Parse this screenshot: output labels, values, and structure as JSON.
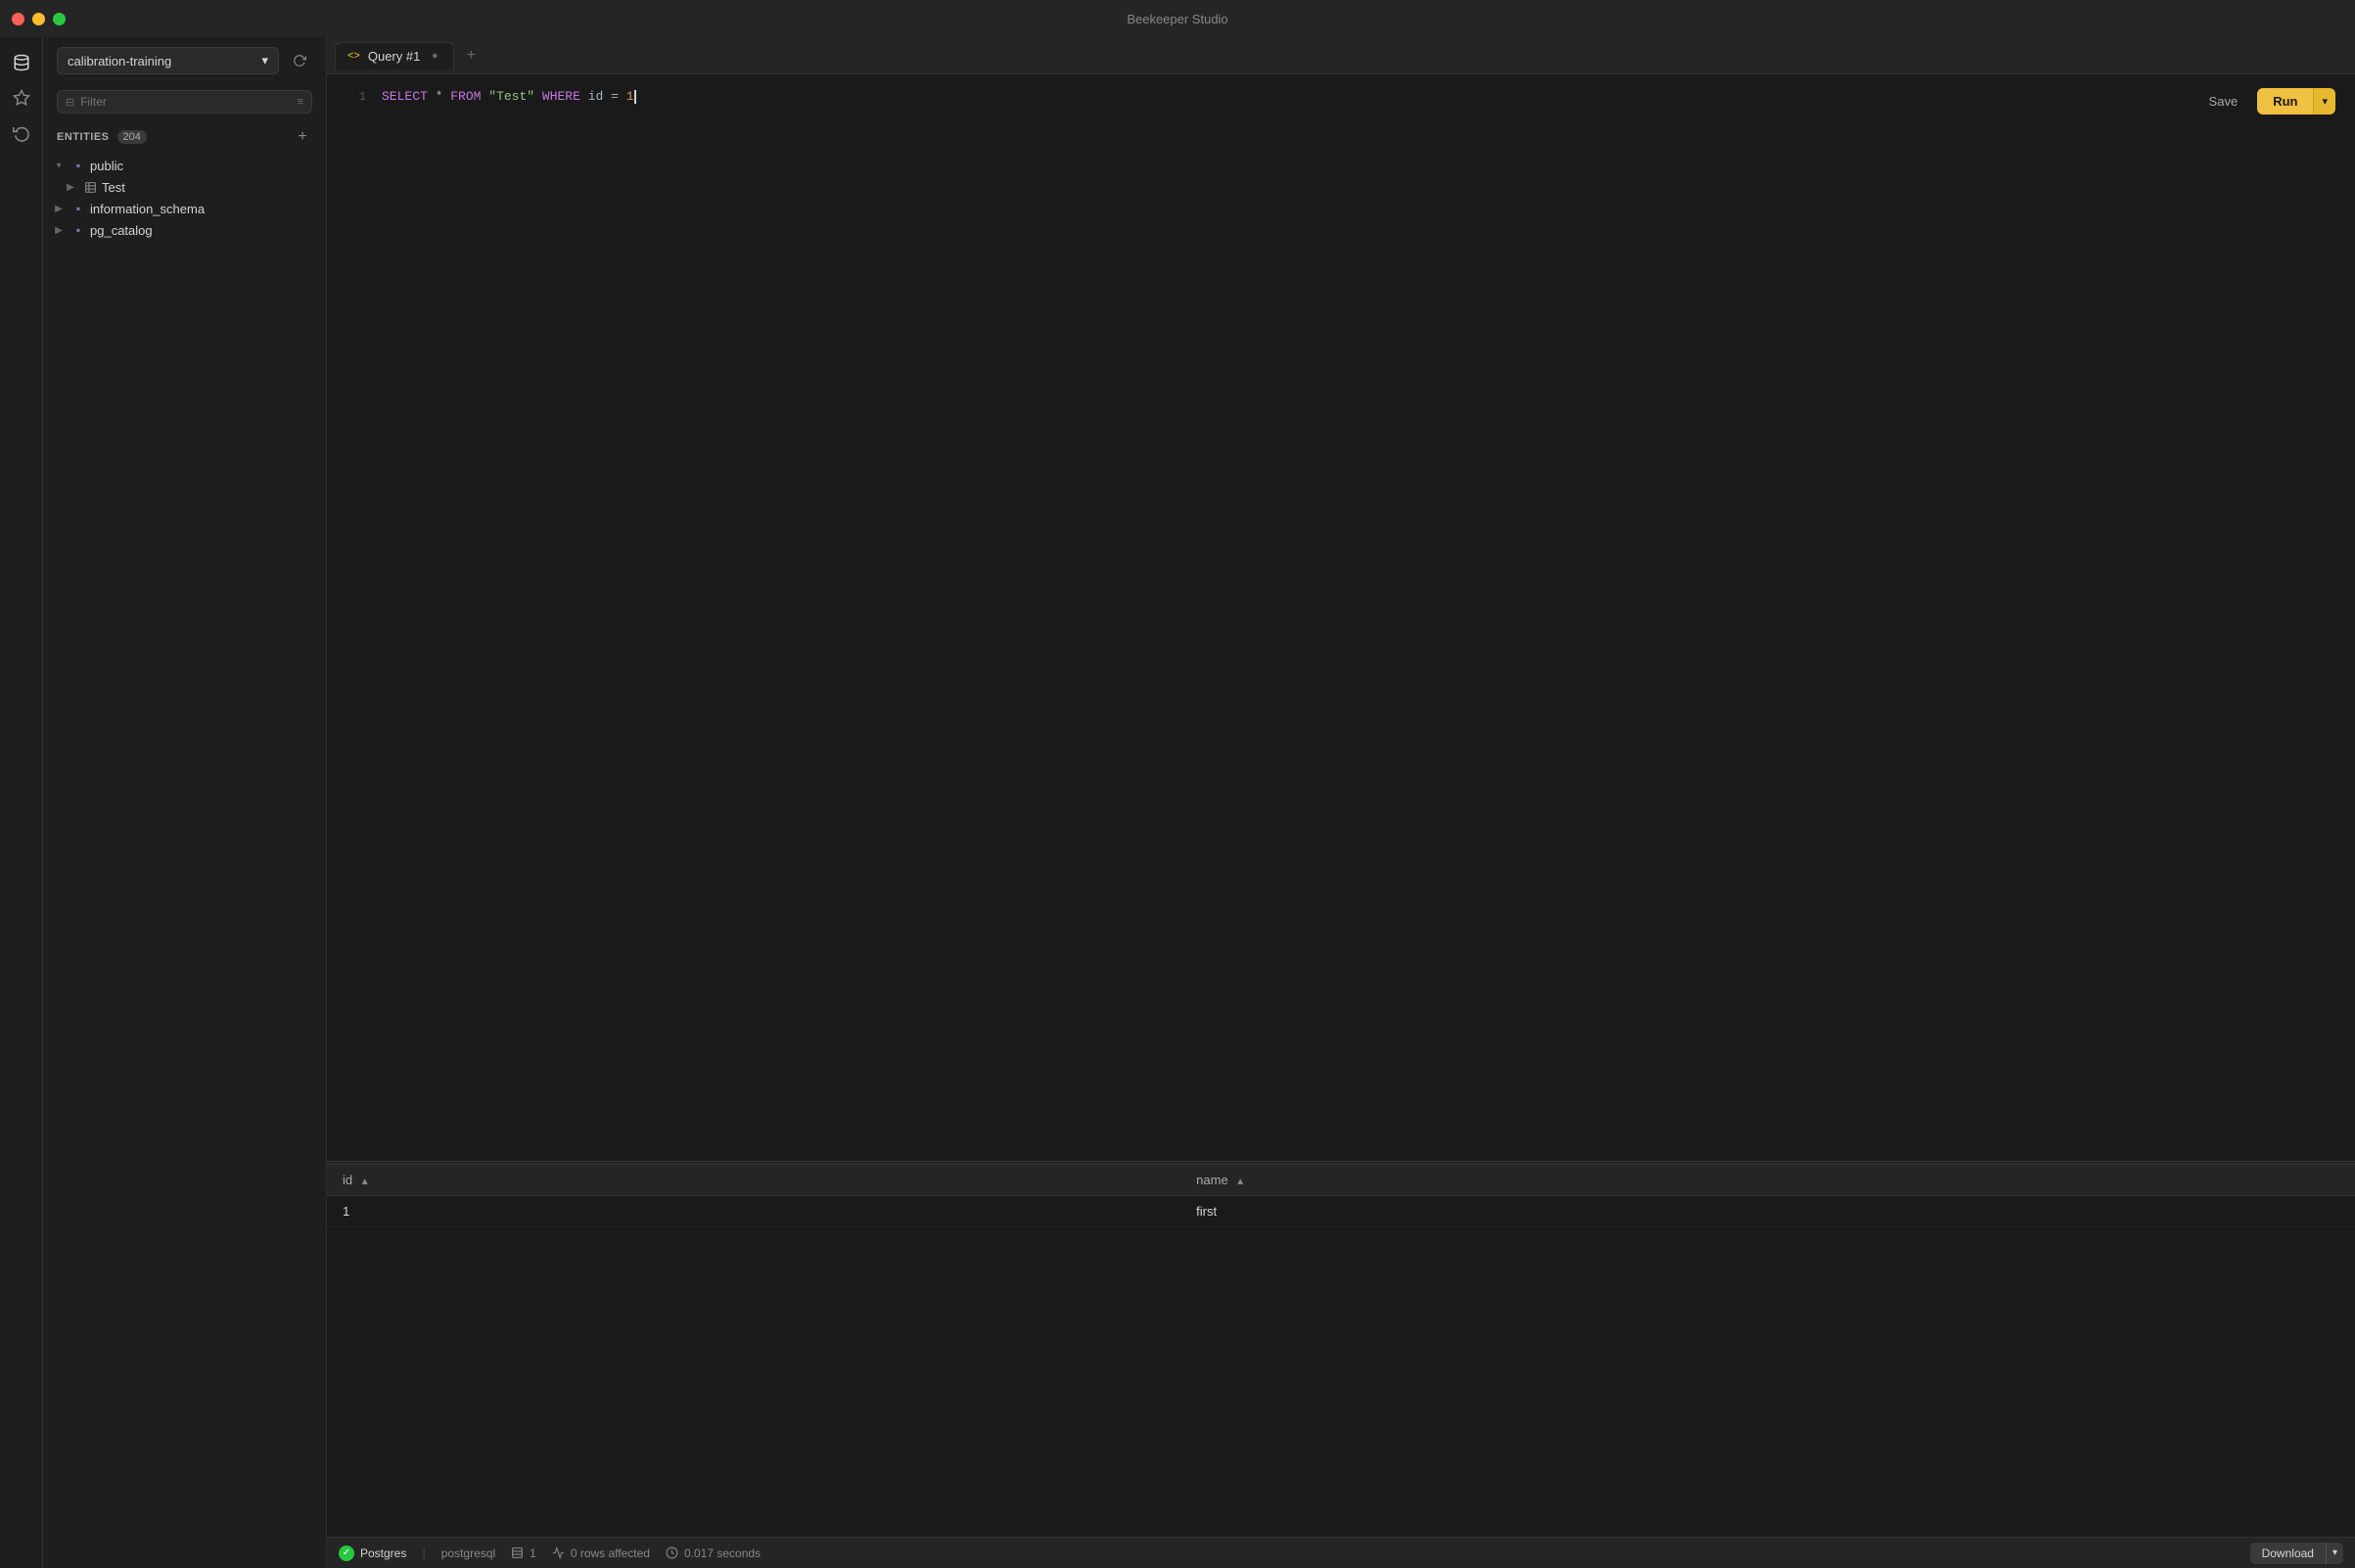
{
  "app": {
    "title": "Beekeeper Studio"
  },
  "titlebar": {
    "title": "Beekeeper Studio"
  },
  "sidebar": {
    "db_selector": "calibration-training",
    "filter_placeholder": "Filter",
    "entities_label": "ENTITIES",
    "entities_count": "204",
    "add_label": "+",
    "tree": [
      {
        "label": "public",
        "type": "schema",
        "expanded": true,
        "children": [
          {
            "label": "Test",
            "type": "table"
          }
        ]
      },
      {
        "label": "information_schema",
        "type": "schema",
        "expanded": false,
        "children": []
      },
      {
        "label": "pg_catalog",
        "type": "schema",
        "expanded": false,
        "children": []
      }
    ]
  },
  "tabs": [
    {
      "label": "Query #1",
      "icon": "<>",
      "active": true
    }
  ],
  "editor": {
    "code": "SELECT * FROM \"Test\" WHERE id = 1",
    "save_label": "Save",
    "run_label": "Run"
  },
  "results": {
    "columns": [
      {
        "label": "id",
        "sort": "asc"
      },
      {
        "label": "name",
        "sort": "asc"
      }
    ],
    "rows": [
      {
        "id": "1",
        "name": "first"
      }
    ]
  },
  "statusbar": {
    "db_name": "Postgres",
    "db_type": "postgresql",
    "row_count": "1",
    "rows_affected_label": "0 rows affected",
    "duration": "0.017 seconds",
    "download_label": "Download"
  }
}
